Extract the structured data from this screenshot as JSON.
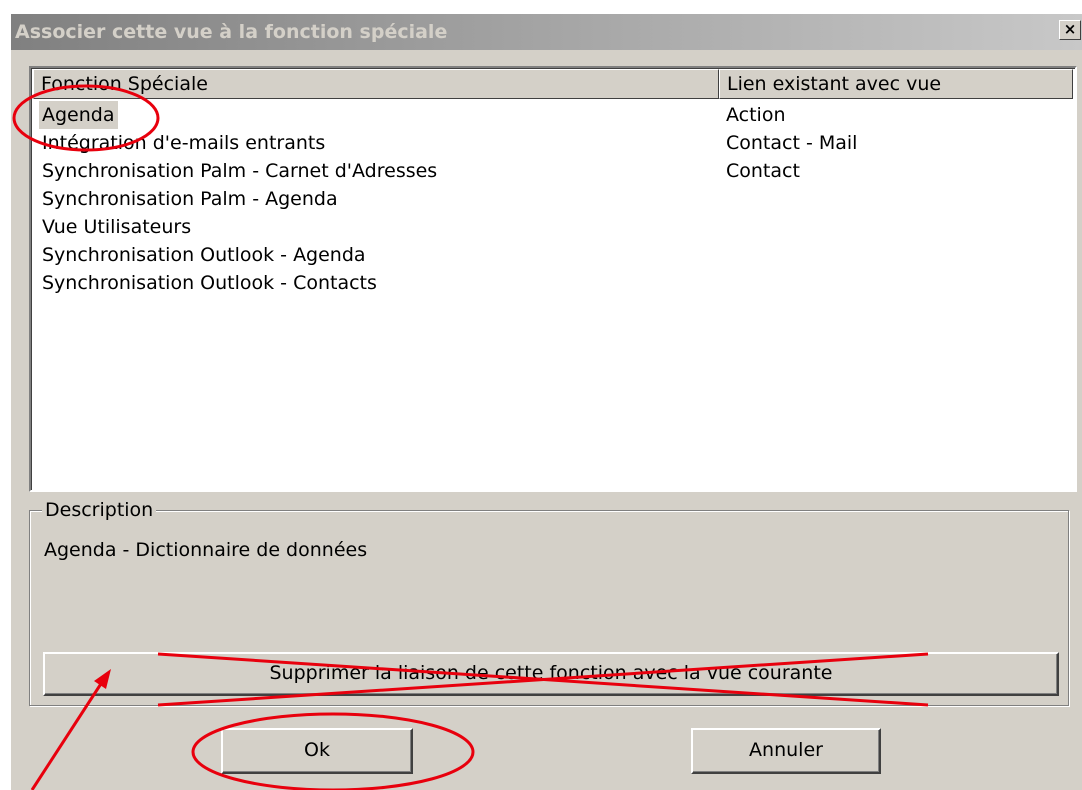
{
  "dialog": {
    "title": "Associer cette vue à la fonction spéciale",
    "close_label": "×"
  },
  "list": {
    "columns": [
      "Fonction Spéciale",
      "Lien existant avec vue"
    ],
    "rows": [
      {
        "function": "Agenda",
        "link": "Action",
        "selected": true
      },
      {
        "function": "Intégration d'e-mails entrants",
        "link": "Contact - Mail"
      },
      {
        "function": "Synchronisation Palm - Carnet d'Adresses",
        "link": "Contact"
      },
      {
        "function": "Synchronisation Palm - Agenda",
        "link": ""
      },
      {
        "function": "Vue Utilisateurs",
        "link": ""
      },
      {
        "function": "Synchronisation Outlook - Agenda",
        "link": ""
      },
      {
        "function": "Synchronisation Outlook - Contacts",
        "link": ""
      }
    ]
  },
  "description": {
    "legend": "Description",
    "text": "Agenda - Dictionnaire de données"
  },
  "buttons": {
    "remove_link": "Supprimer la liaison de cette fonction avec la vue courante",
    "ok": "Ok",
    "cancel": "Annuler"
  },
  "annotations": {
    "color": "#e8000d"
  }
}
